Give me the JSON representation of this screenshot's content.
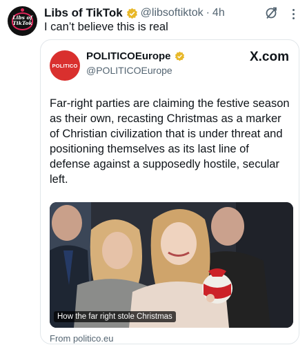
{
  "tweet": {
    "author_name": "Libs of TikTok",
    "handle": "@libsoftiktok",
    "separator": "·",
    "time": "4h",
    "text": "I can’t believe this is real",
    "avatar_text_line1": "Libs of",
    "avatar_text_line2": "TikTok",
    "icons": [
      "verified-badge-icon",
      "grok-icon",
      "more-options-icon"
    ],
    "colors": {
      "verified_gold": "#e8b829",
      "secondary_text": "#536471",
      "brand_red": "#d9302e"
    }
  },
  "card": {
    "source_logo_text": "POLITICO",
    "source_name": "POLITICOEurope",
    "source_handle": "@POLITICOEurope",
    "platform": "X.com",
    "article_lines": [
      "Far-right parties are claiming the festive season",
      "as their own, recasting Christmas as a marker",
      "of Christian civilization that is under threat and",
      "positioning themselves as its last line of",
      "defense against a supposedly hostile, secular",
      "left."
    ],
    "image_caption": "How the far right stole Christmas",
    "from_text": "From politico.eu"
  }
}
